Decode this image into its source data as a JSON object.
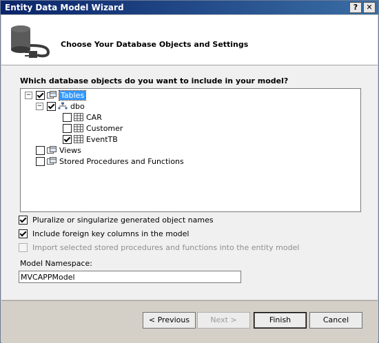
{
  "window": {
    "title": "Entity Data Model Wizard",
    "help_label": "?",
    "close_label": "✕"
  },
  "header": {
    "heading": "Choose Your Database Objects and Settings"
  },
  "question": "Which database objects do you want to include in your model?",
  "tree": {
    "tables": {
      "label": "Tables",
      "checked": true,
      "expanded": true,
      "toggle": "−"
    },
    "dbo": {
      "label": "dbo",
      "checked": true,
      "expanded": true,
      "toggle": "−"
    },
    "car": {
      "label": "CAR",
      "checked": false
    },
    "customer": {
      "label": "Customer",
      "checked": false
    },
    "eventtb": {
      "label": "EventTB",
      "checked": true
    },
    "views": {
      "label": "Views",
      "checked": false
    },
    "procs": {
      "label": "Stored Procedures and Functions",
      "checked": false
    }
  },
  "options": {
    "pluralize": {
      "label": "Pluralize or singularize generated object names",
      "checked": true
    },
    "foreign_keys": {
      "label": "Include foreign key columns in the model",
      "checked": true
    },
    "import_procs": {
      "label": "Import selected stored procedures and functions into the entity model",
      "checked": false,
      "disabled": true
    }
  },
  "namespace": {
    "label": "Model Namespace:",
    "value": "MVCAPPModel"
  },
  "buttons": {
    "previous": "< Previous",
    "next": "Next >",
    "finish": "Finish",
    "cancel": "Cancel"
  }
}
